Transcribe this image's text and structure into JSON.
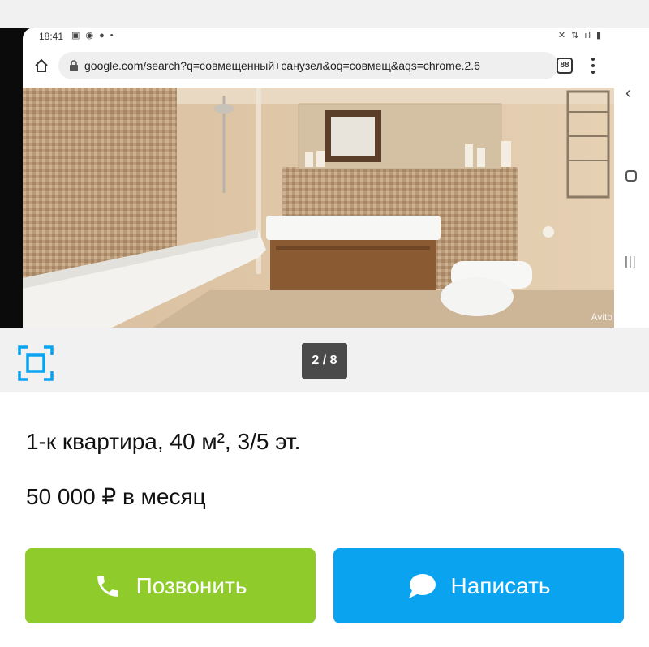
{
  "phone_status": {
    "time": "18:41"
  },
  "browser": {
    "url": "google.com/search?q=совмещенный+санузел&oq=совмещ&aqs=chrome.2.6",
    "tabs_count": "88"
  },
  "photo": {
    "watermark": "Avito"
  },
  "gallery": {
    "counter": "2 / 8"
  },
  "listing": {
    "title": "1-к квартира, 40 м², 3/5 эт.",
    "price": "50 000 ₽ в месяц"
  },
  "actions": {
    "call_label": "Позвонить",
    "write_label": "Написать"
  },
  "colors": {
    "call_button": "#8fcb2b",
    "write_button": "#0aa3f0",
    "fullscreen_icon": "#0aa3f0"
  },
  "icons": {
    "call": "phone-icon",
    "write": "chat-bubble-icon",
    "fullscreen": "fullscreen-icon"
  }
}
